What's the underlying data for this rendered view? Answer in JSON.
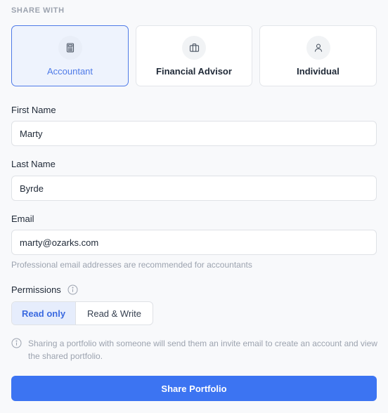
{
  "share_with": {
    "label": "SHARE WITH",
    "options": [
      {
        "label": "Accountant",
        "icon": "calculator-icon",
        "selected": true
      },
      {
        "label": "Financial Advisor",
        "icon": "briefcase-icon",
        "selected": false
      },
      {
        "label": "Individual",
        "icon": "user-icon",
        "selected": false
      }
    ]
  },
  "form": {
    "first_name": {
      "label": "First Name",
      "value": "Marty"
    },
    "last_name": {
      "label": "Last Name",
      "value": "Byrde"
    },
    "email": {
      "label": "Email",
      "value": "marty@ozarks.com",
      "hint": "Professional email addresses are recommended for accountants"
    }
  },
  "permissions": {
    "label": "Permissions",
    "options": [
      "Read only",
      "Read & Write"
    ],
    "selected": "Read only"
  },
  "note": "Sharing a portfolio with someone will send them an invite email to create an account and view the shared portfolio.",
  "submit_label": "Share Portfolio",
  "colors": {
    "accent": "#3c74f2",
    "selected_border": "#4f7be8",
    "selected_bg": "#eef3fd",
    "muted": "#9ca3af"
  }
}
